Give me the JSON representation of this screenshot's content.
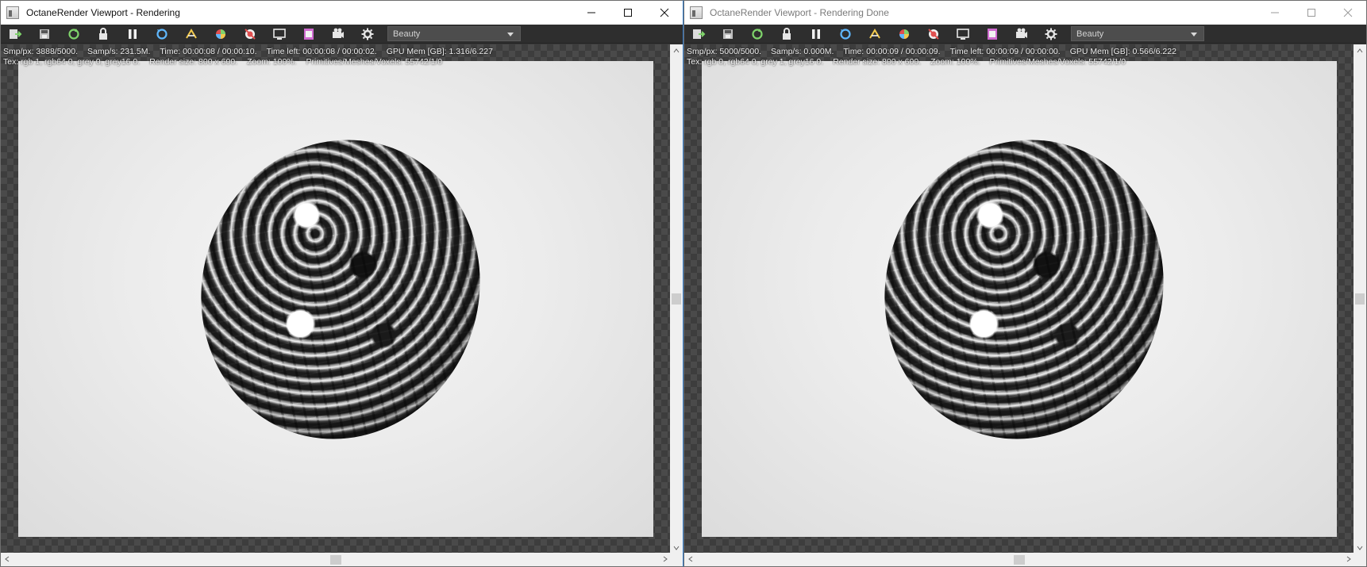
{
  "windows": [
    {
      "title": "OctaneRender Viewport - Rendering",
      "render_pass": "Beauty",
      "stats_line1": {
        "samples_per_px": "Smp/px: 3888/5000.",
        "samples_per_sec": "Samp/s: 231.5M.",
        "time": "Time: 00:00:08 / 00:00:10.",
        "time_left": "Time left: 00:00:08 / 00:00:02.",
        "gpu_mem": "GPU Mem [GB]: 1.316/6.227"
      },
      "stats_line2": {
        "tex": "Tex: rgb 1, rgb64 0, grey 0, grey16 0.",
        "render_size": "Render size: 800 x 600.",
        "zoom": "Zoom: 100%.",
        "primitives": "Primitives/Meshes/Voxels: 55742/1/0"
      }
    },
    {
      "title": "OctaneRender Viewport - Rendering Done",
      "render_pass": "Beauty",
      "stats_line1": {
        "samples_per_px": "Smp/px: 5000/5000.",
        "samples_per_sec": "Samp/s: 0.000M.",
        "time": "Time: 00:00:09 / 00:00:09.",
        "time_left": "Time left: 00:00:09 / 00:00:00.",
        "gpu_mem": "GPU Mem [GB]: 0.566/6.222"
      },
      "stats_line2": {
        "tex": "Tex: rgb 0, rgb64 0, grey 1, grey16 0.",
        "render_size": "Render size: 800 x 600.",
        "zoom": "Zoom: 100%.",
        "primitives": "Primitives/Meshes/Voxels: 55742/1/0"
      }
    }
  ],
  "toolbar_icons": [
    "export-render-icon",
    "save-image-icon",
    "recompile-icon",
    "lock-viewport-icon",
    "pause-icon",
    "restart-render-icon",
    "focus-picker-icon",
    "color-picker-icon",
    "material-picker-icon",
    "region-render-icon",
    "film-region-icon",
    "camera-icon",
    "settings-gear-icon"
  ],
  "colors": {
    "toolbar_bg": "#2e2e2e",
    "icon_green": "#7fd46b",
    "icon_yellow": "#f2c94c",
    "icon_red": "#e05050",
    "active_border": "#2f79c8"
  }
}
